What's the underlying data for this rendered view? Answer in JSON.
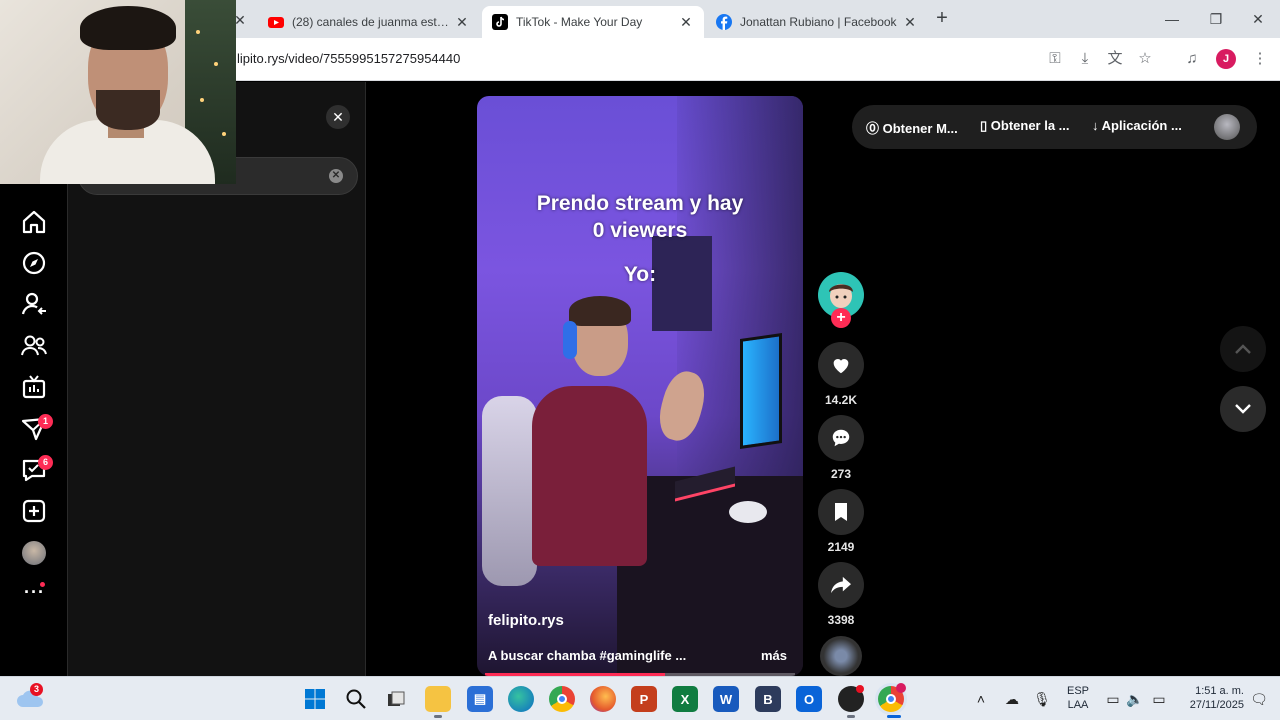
{
  "browser": {
    "tabs": [
      {
        "title": "(28) canales de juanma esteves",
        "favicon": "youtube-icon",
        "active": false
      },
      {
        "title": "TikTok - Make Your Day",
        "favicon": "tiktok-icon",
        "active": true
      },
      {
        "title": "Jonattan Rubiano | Facebook",
        "favicon": "facebook-icon",
        "active": false
      }
    ],
    "url": "lipito.rys/video/7555995157275954440",
    "profile_initial": "J"
  },
  "sidebar": {
    "items": [
      {
        "name": "home-icon"
      },
      {
        "name": "explore-icon"
      },
      {
        "name": "following-icon"
      },
      {
        "name": "friends-icon"
      },
      {
        "name": "live-icon"
      },
      {
        "name": "messages-icon",
        "badge": "1"
      },
      {
        "name": "inbox-icon",
        "badge": "6"
      },
      {
        "name": "upload-icon"
      }
    ]
  },
  "video": {
    "caption_line1": "Prendo stream y hay",
    "caption_line2": "0 viewers",
    "caption_line3": "Yo:",
    "username": "felipito.rys",
    "description": "A buscar chamba #gaminglife ...",
    "more_label": "más",
    "progress": 0.58
  },
  "actions": {
    "likes": "14.2K",
    "comments": "273",
    "saves": "2149",
    "shares": "3398"
  },
  "promo": {
    "item1": "Obtener M...",
    "item2": "Obtener la ...",
    "item3": "Aplicación ..."
  },
  "taskbar": {
    "weather_badge": "3",
    "lang_line1": "ESP",
    "lang_line2": "LAA",
    "time": "1:51 a. m.",
    "date": "27/11/2025"
  },
  "colors": {
    "accent": "#fe2c55",
    "page_bg": "#000000",
    "panel_bg": "#121212"
  }
}
